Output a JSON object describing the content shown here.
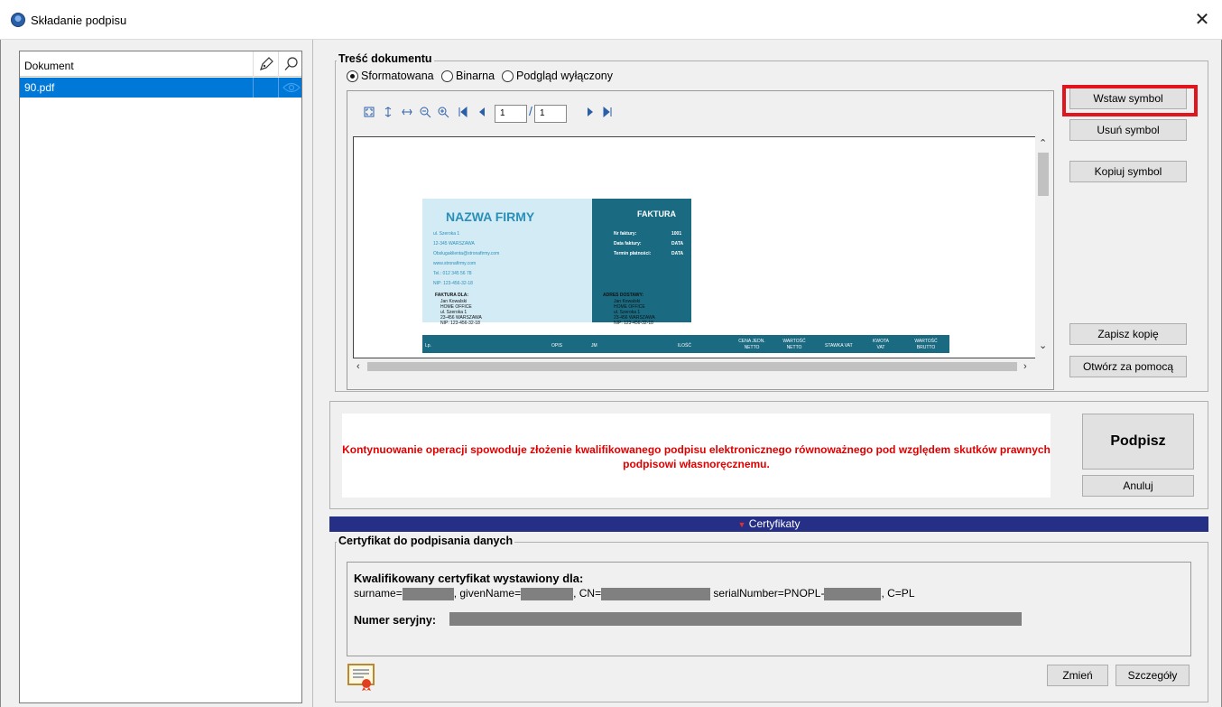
{
  "window": {
    "title": "Składanie podpisu",
    "close_glyph": "✕"
  },
  "document_list": {
    "header": "Dokument",
    "header_icons": [
      "pen-icon",
      "search-icon"
    ],
    "items": [
      {
        "name": "90.pdf",
        "icon": "eye-icon",
        "selected": true
      }
    ]
  },
  "content": {
    "group_title": "Treść dokumentu",
    "modes": [
      {
        "label": "Sformatowana",
        "selected": true
      },
      {
        "label": "Binarna",
        "selected": false
      },
      {
        "label": "Podgląd wyłączony",
        "selected": false
      }
    ],
    "toolbar": {
      "page_current": "1",
      "page_total": "1",
      "page_sep": "/"
    },
    "side_buttons": {
      "insert_symbol": "Wstaw symbol",
      "remove_symbol": "Usuń symbol",
      "copy_symbol": "Kopiuj symbol",
      "save_copy": "Zapisz kopię",
      "open_with": "Otwórz za pomocą"
    }
  },
  "invoice_preview": {
    "company_name": "NAZWA FIRMY",
    "company_lines": [
      "ul. Szeroka 1",
      "12-345 WARSZAWA",
      "Obslugaklienta@stronafirmy.com",
      "www.stronafirmy.com",
      "Tel.: 012 345 56 78",
      "NIP: 123-456-32-18"
    ],
    "invoice_title": "FAKTURA",
    "invoice_fields": [
      {
        "label": "Nr faktury:",
        "value": "1001"
      },
      {
        "label": "Data faktury:",
        "value": "DATA"
      },
      {
        "label": "Termin płatności:",
        "value": "DATA"
      }
    ],
    "bill_to_title": "FAKTURA DLA:",
    "bill_to_lines": [
      "Jan Kowalski",
      "HOME OFFICE",
      "ul. Szeroka 1",
      "23-456 WARSZAWA",
      "NIP: 123-456-32-18"
    ],
    "ship_to_title": "ADRES DOSTAWY:",
    "ship_to_lines": [
      "Jan Kowalski",
      "HOME OFFICE",
      "ul. Szeroka 1",
      "23-456 WARSZAWA",
      "NIP: 123-456-32-18"
    ],
    "table_headers": [
      "Lp.",
      "OPIS",
      "JM",
      "ILOŚĆ",
      "CENA JEDN. NETTO",
      "WARTOŚĆ NETTO",
      "STAWKA VAT",
      "KWOTA VAT",
      "WARTOŚĆ BRUTTO"
    ]
  },
  "signing": {
    "warning": "Kontynuowanie operacji spowoduje złożenie kwalifikowanego podpisu elektronicznego równoważnego pod względem skutków prawnych podpisowi własnoręcznemu.",
    "sign_button": "Podpisz",
    "cancel_button": "Anuluj"
  },
  "certificates": {
    "bar_label": "Certyfikaty",
    "group_title": "Certyfikat do podpisania danych",
    "issued_for_title": "Kwalifikowany certyfikat wystawiony dla:",
    "subject_parts": {
      "surname": "surname=",
      "given_name": ", givenName=",
      "cn": ", CN=",
      "serial": " serialNumber=PNOPL-",
      "country": ", C=PL"
    },
    "serial_label": "Numer seryjny:",
    "change_button": "Zmień",
    "details_button": "Szczegóły"
  }
}
